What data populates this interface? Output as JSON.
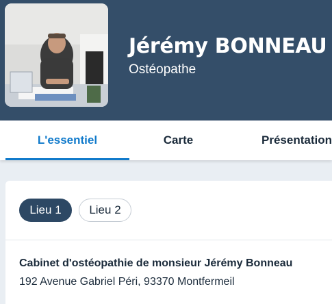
{
  "profile": {
    "name": "Jérémy BONNEAU",
    "profession": "Ostéopathe"
  },
  "tabs": [
    {
      "label": "L'essentiel",
      "active": true
    },
    {
      "label": "Carte",
      "active": false
    },
    {
      "label": "Présentation",
      "active": false
    }
  ],
  "locations": {
    "chips": [
      {
        "label": "Lieu 1",
        "selected": true
      },
      {
        "label": "Lieu 2",
        "selected": false
      }
    ],
    "cabinet_name": "Cabinet d'ostéopathie de monsieur Jérémy Bonneau",
    "address": "192 Avenue Gabriel Péri, 93370 Montfermeil"
  },
  "colors": {
    "header_bg": "#344e69",
    "accent": "#107acb",
    "chip_selected_bg": "#2d4864"
  }
}
